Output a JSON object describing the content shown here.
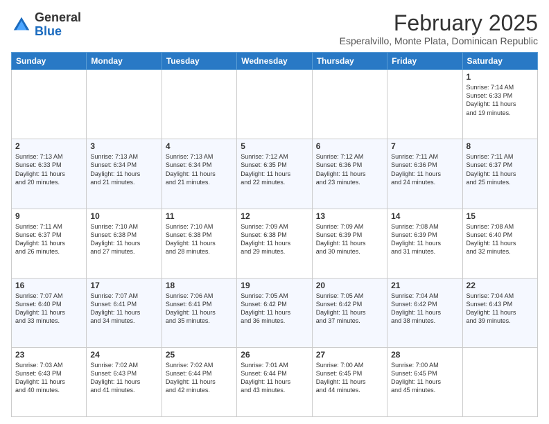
{
  "header": {
    "logo_general": "General",
    "logo_blue": "Blue",
    "title": "February 2025",
    "subtitle": "Esperalvillo, Monte Plata, Dominican Republic"
  },
  "weekdays": [
    "Sunday",
    "Monday",
    "Tuesday",
    "Wednesday",
    "Thursday",
    "Friday",
    "Saturday"
  ],
  "weeks": [
    [
      {
        "day": "",
        "info": ""
      },
      {
        "day": "",
        "info": ""
      },
      {
        "day": "",
        "info": ""
      },
      {
        "day": "",
        "info": ""
      },
      {
        "day": "",
        "info": ""
      },
      {
        "day": "",
        "info": ""
      },
      {
        "day": "1",
        "info": "Sunrise: 7:14 AM\nSunset: 6:33 PM\nDaylight: 11 hours\nand 19 minutes."
      }
    ],
    [
      {
        "day": "2",
        "info": "Sunrise: 7:13 AM\nSunset: 6:33 PM\nDaylight: 11 hours\nand 20 minutes."
      },
      {
        "day": "3",
        "info": "Sunrise: 7:13 AM\nSunset: 6:34 PM\nDaylight: 11 hours\nand 21 minutes."
      },
      {
        "day": "4",
        "info": "Sunrise: 7:13 AM\nSunset: 6:34 PM\nDaylight: 11 hours\nand 21 minutes."
      },
      {
        "day": "5",
        "info": "Sunrise: 7:12 AM\nSunset: 6:35 PM\nDaylight: 11 hours\nand 22 minutes."
      },
      {
        "day": "6",
        "info": "Sunrise: 7:12 AM\nSunset: 6:36 PM\nDaylight: 11 hours\nand 23 minutes."
      },
      {
        "day": "7",
        "info": "Sunrise: 7:11 AM\nSunset: 6:36 PM\nDaylight: 11 hours\nand 24 minutes."
      },
      {
        "day": "8",
        "info": "Sunrise: 7:11 AM\nSunset: 6:37 PM\nDaylight: 11 hours\nand 25 minutes."
      }
    ],
    [
      {
        "day": "9",
        "info": "Sunrise: 7:11 AM\nSunset: 6:37 PM\nDaylight: 11 hours\nand 26 minutes."
      },
      {
        "day": "10",
        "info": "Sunrise: 7:10 AM\nSunset: 6:38 PM\nDaylight: 11 hours\nand 27 minutes."
      },
      {
        "day": "11",
        "info": "Sunrise: 7:10 AM\nSunset: 6:38 PM\nDaylight: 11 hours\nand 28 minutes."
      },
      {
        "day": "12",
        "info": "Sunrise: 7:09 AM\nSunset: 6:38 PM\nDaylight: 11 hours\nand 29 minutes."
      },
      {
        "day": "13",
        "info": "Sunrise: 7:09 AM\nSunset: 6:39 PM\nDaylight: 11 hours\nand 30 minutes."
      },
      {
        "day": "14",
        "info": "Sunrise: 7:08 AM\nSunset: 6:39 PM\nDaylight: 11 hours\nand 31 minutes."
      },
      {
        "day": "15",
        "info": "Sunrise: 7:08 AM\nSunset: 6:40 PM\nDaylight: 11 hours\nand 32 minutes."
      }
    ],
    [
      {
        "day": "16",
        "info": "Sunrise: 7:07 AM\nSunset: 6:40 PM\nDaylight: 11 hours\nand 33 minutes."
      },
      {
        "day": "17",
        "info": "Sunrise: 7:07 AM\nSunset: 6:41 PM\nDaylight: 11 hours\nand 34 minutes."
      },
      {
        "day": "18",
        "info": "Sunrise: 7:06 AM\nSunset: 6:41 PM\nDaylight: 11 hours\nand 35 minutes."
      },
      {
        "day": "19",
        "info": "Sunrise: 7:05 AM\nSunset: 6:42 PM\nDaylight: 11 hours\nand 36 minutes."
      },
      {
        "day": "20",
        "info": "Sunrise: 7:05 AM\nSunset: 6:42 PM\nDaylight: 11 hours\nand 37 minutes."
      },
      {
        "day": "21",
        "info": "Sunrise: 7:04 AM\nSunset: 6:42 PM\nDaylight: 11 hours\nand 38 minutes."
      },
      {
        "day": "22",
        "info": "Sunrise: 7:04 AM\nSunset: 6:43 PM\nDaylight: 11 hours\nand 39 minutes."
      }
    ],
    [
      {
        "day": "23",
        "info": "Sunrise: 7:03 AM\nSunset: 6:43 PM\nDaylight: 11 hours\nand 40 minutes."
      },
      {
        "day": "24",
        "info": "Sunrise: 7:02 AM\nSunset: 6:43 PM\nDaylight: 11 hours\nand 41 minutes."
      },
      {
        "day": "25",
        "info": "Sunrise: 7:02 AM\nSunset: 6:44 PM\nDaylight: 11 hours\nand 42 minutes."
      },
      {
        "day": "26",
        "info": "Sunrise: 7:01 AM\nSunset: 6:44 PM\nDaylight: 11 hours\nand 43 minutes."
      },
      {
        "day": "27",
        "info": "Sunrise: 7:00 AM\nSunset: 6:45 PM\nDaylight: 11 hours\nand 44 minutes."
      },
      {
        "day": "28",
        "info": "Sunrise: 7:00 AM\nSunset: 6:45 PM\nDaylight: 11 hours\nand 45 minutes."
      },
      {
        "day": "",
        "info": ""
      }
    ]
  ]
}
